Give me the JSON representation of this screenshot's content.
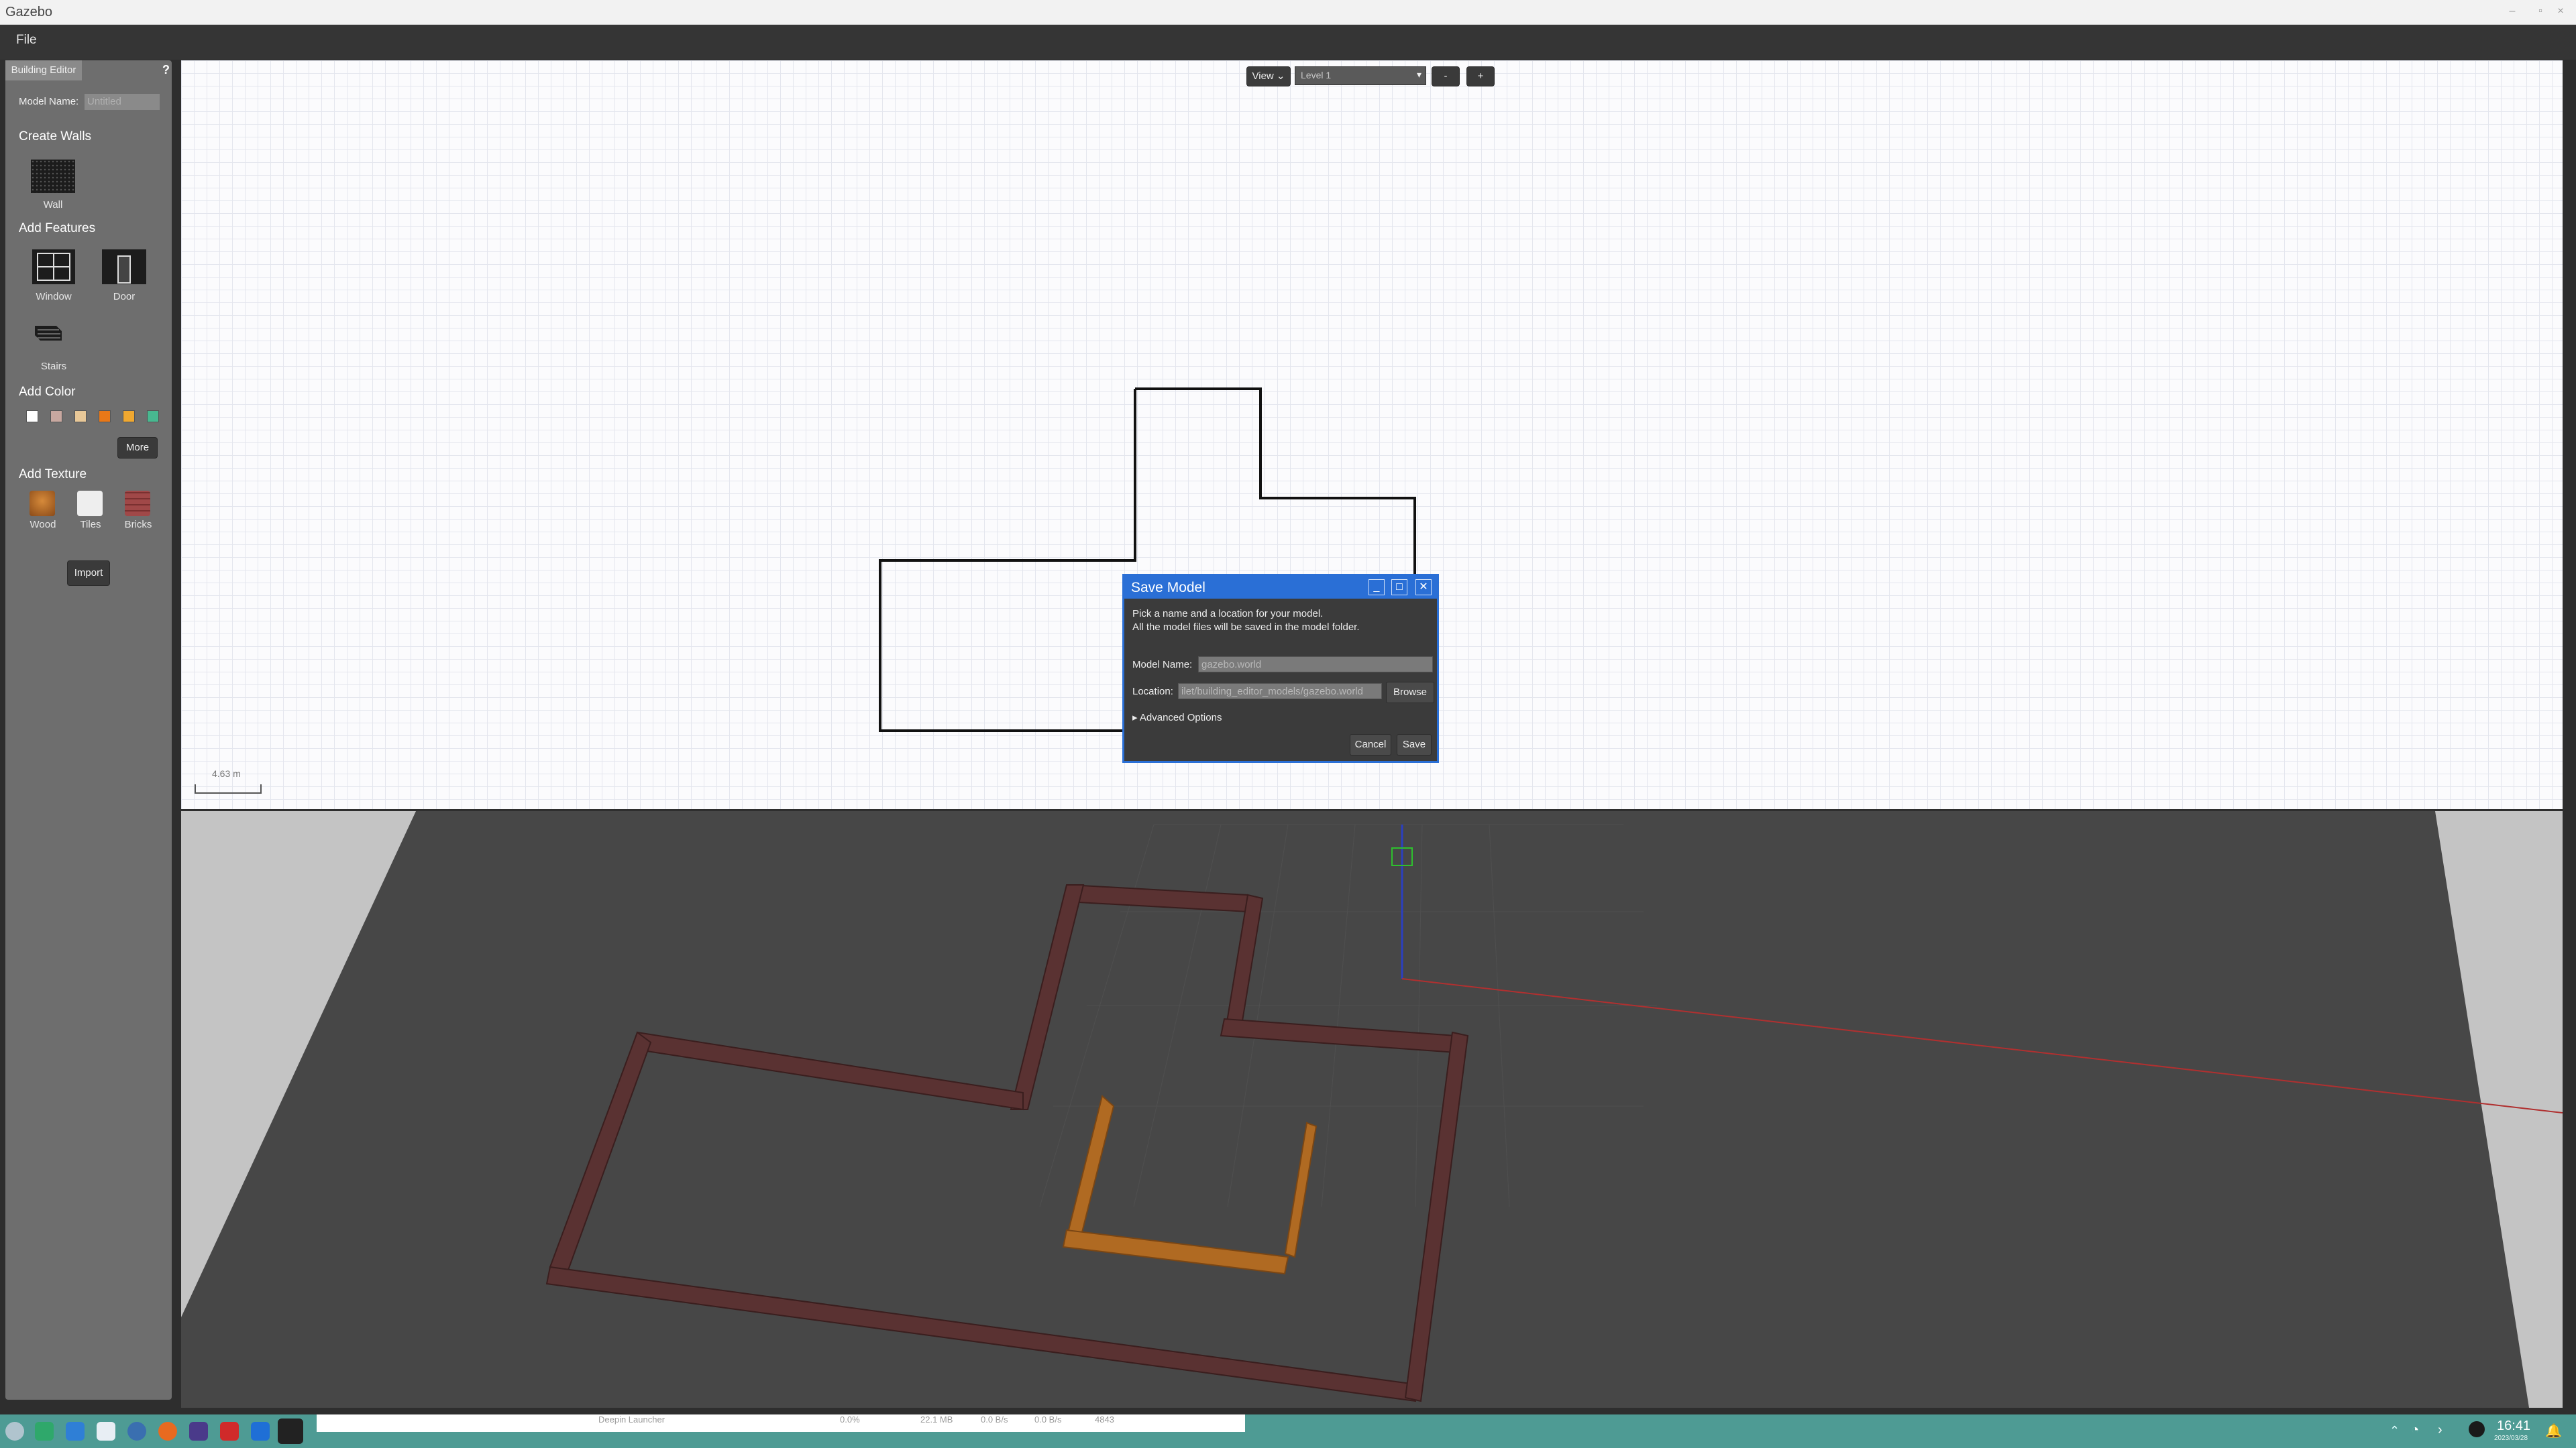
{
  "window": {
    "title": "Gazebo"
  },
  "menu": {
    "file": "File"
  },
  "panel": {
    "tab": "Building Editor",
    "help": "?",
    "model_name_label": "Model Name:",
    "model_name_value": "Untitled",
    "create_walls": "Create Walls",
    "wall": "Wall",
    "add_features": "Add Features",
    "window": "Window",
    "door": "Door",
    "stairs": "Stairs",
    "add_color": "Add Color",
    "colors": [
      "#ffffff",
      "#c8a8a0",
      "#e8c898",
      "#e87818",
      "#f0a830",
      "#48b890"
    ],
    "more": "More",
    "add_texture": "Add Texture",
    "wood": "Wood",
    "tiles": "Tiles",
    "bricks": "Bricks",
    "import": "Import"
  },
  "toolbar": {
    "view": "View",
    "level": "Level 1",
    "minus": "-",
    "plus": "+"
  },
  "scale": {
    "label": "4.63 m"
  },
  "dialog": {
    "title": "Save Model",
    "line1": "Pick a name and a location for your model.",
    "line2": "All the model files will be saved in the model folder.",
    "name_label": "Model Name:",
    "name_value": "gazebo.world",
    "location_label": "Location:",
    "location_value": "ilet/building_editor_models/gazebo.world",
    "browse": "Browse",
    "advanced": "Advanced Options",
    "cancel": "Cancel",
    "save": "Save"
  },
  "taskbar": {
    "app_item": "Deepin Launcher",
    "col1": "0.0%",
    "col2": "22.1 MB",
    "col3": "0.0 B/s",
    "col4": "0.0 B/s",
    "col5": "4843",
    "time": "16:41",
    "date": "2023/03/28"
  }
}
